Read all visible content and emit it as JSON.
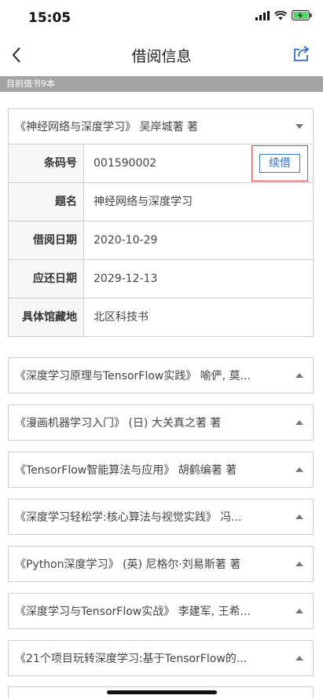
{
  "status_bar": {
    "time": "15:05"
  },
  "nav": {
    "title": "借阅信息"
  },
  "summary": {
    "count_text": "目前借书9本"
  },
  "expanded_book": {
    "title": "《神经网络与深度学习》 吴岸城著 著",
    "renew_label": "续借",
    "rows": [
      {
        "label": "条码号",
        "value": "001590002"
      },
      {
        "label": "题名",
        "value": "神经网络与深度学习"
      },
      {
        "label": "借阅日期",
        "value": "2020-10-29"
      },
      {
        "label": "应还日期",
        "value": "2029-12-13"
      },
      {
        "label": "具体馆藏地",
        "value": "北区科技书"
      }
    ]
  },
  "books": [
    {
      "title": "《深度学习原理与TensorFlow实践》 喻俨, 莫..."
    },
    {
      "title": "《漫画机器学习入门》 (日) 大关真之著 著"
    },
    {
      "title": "《TensorFlow智能算法与应用》 胡鹤编著 著"
    },
    {
      "title": "《深度学习轻松学:核心算法与视觉实践》 冯..."
    },
    {
      "title": "《Python深度学习》 (英) 尼格尔·刘易斯著 著"
    },
    {
      "title": "《深度学习与TensorFlow实战》 李建军, 王希..."
    },
    {
      "title": "《21个项目玩转深度学习:基于TensorFlow的..."
    }
  ],
  "colors": {
    "accent": "#2f6fd0",
    "highlight": "#e04040",
    "count_bar": "#a3a3a3"
  },
  "icons": [
    "signal-icon",
    "wifi-icon",
    "battery-charging-icon",
    "back-arrow-icon",
    "share-icon",
    "caret-down-icon",
    "caret-up-icon"
  ]
}
